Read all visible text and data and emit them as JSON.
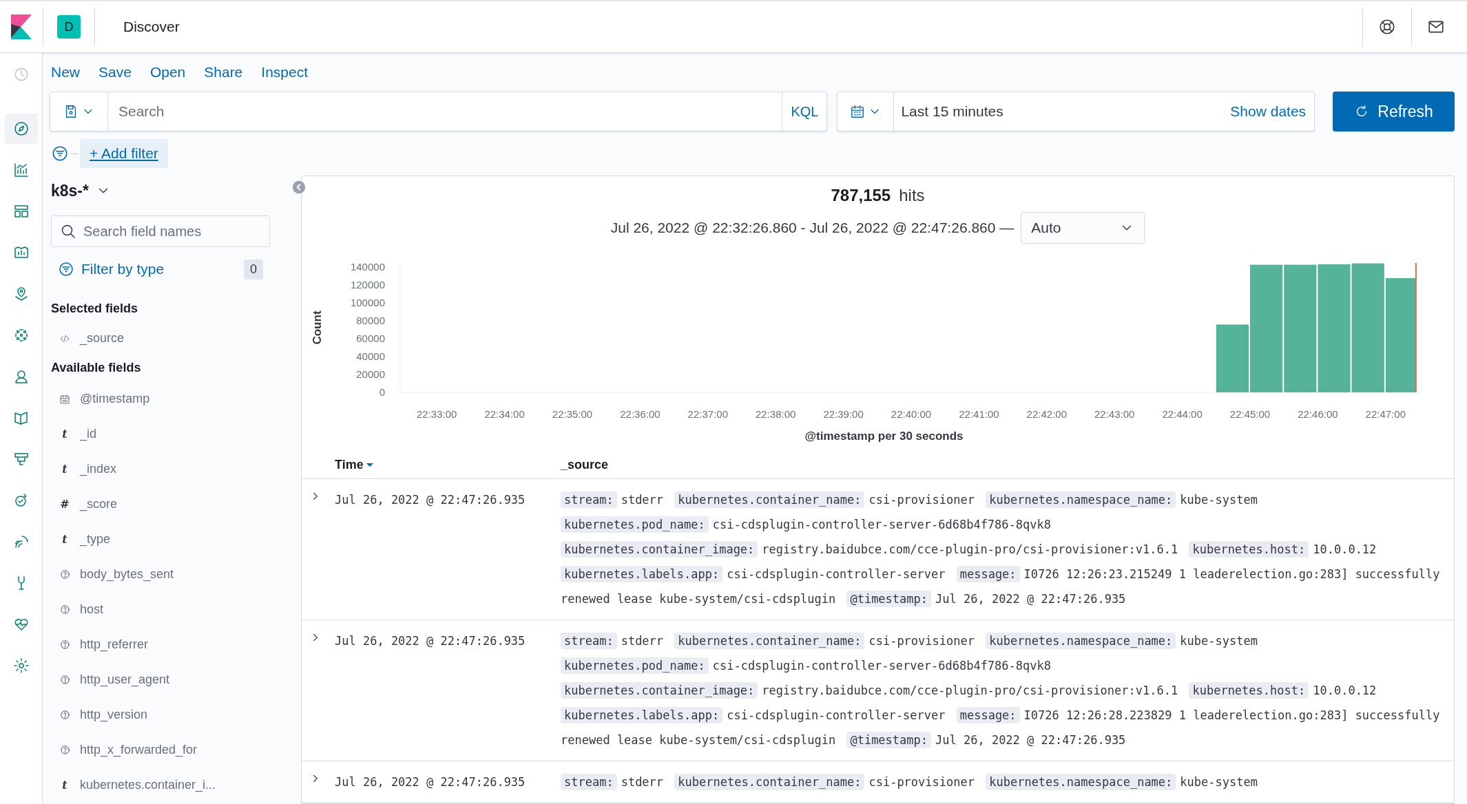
{
  "header": {
    "avatar": "D",
    "title": "Discover"
  },
  "nav": [
    {
      "selected": true
    },
    {
      "selected": false
    },
    {
      "selected": false
    },
    {
      "selected": false
    },
    {
      "selected": false
    },
    {
      "selected": false
    },
    {
      "selected": false
    },
    {
      "selected": false
    },
    {
      "selected": false
    },
    {
      "selected": false
    },
    {
      "selected": false
    },
    {
      "selected": false
    },
    {
      "selected": false
    },
    {
      "selected": false
    }
  ],
  "menu": [
    "New",
    "Save",
    "Open",
    "Share",
    "Inspect"
  ],
  "query": {
    "placeholder": "Search",
    "language": "KQL"
  },
  "time": {
    "range": "Last 15 minutes",
    "show_dates": "Show dates",
    "refresh": "Refresh"
  },
  "filter": {
    "add": "+ Add filter"
  },
  "sidebar": {
    "index_pattern": "k8s-*",
    "search_placeholder": "Search field names",
    "filter_by_type": "Filter by type",
    "filter_count": "0",
    "selected_heading": "Selected fields",
    "selected_fields": [
      {
        "kind": "source",
        "name": "_source"
      }
    ],
    "available_heading": "Available fields",
    "available_fields": [
      {
        "kind": "date",
        "name": "@timestamp"
      },
      {
        "kind": "glyph",
        "glyph": "t",
        "name": "_id"
      },
      {
        "kind": "glyph",
        "glyph": "t",
        "name": "_index"
      },
      {
        "kind": "glyph",
        "glyph": "#",
        "name": "_score"
      },
      {
        "kind": "glyph",
        "glyph": "t",
        "name": "_type"
      },
      {
        "kind": "unknown",
        "name": "body_bytes_sent"
      },
      {
        "kind": "unknown",
        "name": "host"
      },
      {
        "kind": "unknown",
        "name": "http_referrer"
      },
      {
        "kind": "unknown",
        "name": "http_user_agent"
      },
      {
        "kind": "unknown",
        "name": "http_version"
      },
      {
        "kind": "unknown",
        "name": "http_x_forwarded_for"
      },
      {
        "kind": "glyph",
        "glyph": "t",
        "name": "kubernetes.container_i..."
      }
    ]
  },
  "hits": {
    "count": "787,155",
    "label": "hits",
    "range": "Jul 26, 2022 @ 22:32:26.860 - Jul 26, 2022 @ 22:47:26.860 —",
    "interval": "Auto"
  },
  "chart_data": {
    "type": "bar",
    "xlabel": "@timestamp per 30 seconds",
    "ylabel": "Count",
    "categories": [
      null,
      "22:33:00",
      null,
      "22:34:00",
      null,
      "22:35:00",
      null,
      "22:36:00",
      null,
      "22:37:00",
      null,
      "22:38:00",
      null,
      "22:39:00",
      null,
      "22:40:00",
      null,
      "22:41:00",
      null,
      "22:42:00",
      null,
      "22:43:00",
      null,
      "22:44:00",
      null,
      "22:45:00",
      null,
      "22:46:00",
      null,
      "22:47:00"
    ],
    "series": [
      {
        "color": "#54b399",
        "values": [
          0,
          0,
          0,
          0,
          0,
          0,
          0,
          0,
          0,
          0,
          0,
          0,
          0,
          0,
          0,
          0,
          0,
          0,
          0,
          0,
          0,
          0,
          0,
          0,
          76000,
          143000,
          143000,
          143500,
          144500,
          128000
        ]
      }
    ],
    "ylim": [
      0,
      145000
    ],
    "yticks": [
      0,
      20000,
      40000,
      60000,
      80000,
      100000,
      120000,
      140000
    ]
  },
  "table": {
    "columns": [
      "Time",
      "_source"
    ],
    "rows": [
      {
        "time": "Jul 26, 2022 @ 22:47:26.935",
        "fields": [
          {
            "key": "stream:",
            "value": "stderr"
          },
          {
            "key": "kubernetes.container_name:",
            "value": "csi-provisioner"
          },
          {
            "key": "kubernetes.namespace_name:",
            "value": "kube-system"
          },
          {
            "key": "kubernetes.pod_name:",
            "value": "csi-cdsplugin-controller-server-6d68b4f786-8qvk8"
          },
          {
            "key": "kubernetes.container_image:",
            "value": "registry.baidubce.com/cce-plugin-pro/csi-provisioner:v1.6.1"
          },
          {
            "key": "kubernetes.host:",
            "value": "10.0.0.12"
          },
          {
            "key": "kubernetes.labels.app:",
            "value": "csi-cdsplugin-controller-server"
          },
          {
            "key": "message:",
            "value": "I0726 12:26:23.215249 1 leaderelection.go:283] successfully renewed lease kube-system/csi-cdsplugin"
          },
          {
            "key": "@timestamp:",
            "value": "Jul 26, 2022 @ 22:47:26.935"
          }
        ]
      },
      {
        "time": "Jul 26, 2022 @ 22:47:26.935",
        "fields": [
          {
            "key": "stream:",
            "value": "stderr"
          },
          {
            "key": "kubernetes.container_name:",
            "value": "csi-provisioner"
          },
          {
            "key": "kubernetes.namespace_name:",
            "value": "kube-system"
          },
          {
            "key": "kubernetes.pod_name:",
            "value": "csi-cdsplugin-controller-server-6d68b4f786-8qvk8"
          },
          {
            "key": "kubernetes.container_image:",
            "value": "registry.baidubce.com/cce-plugin-pro/csi-provisioner:v1.6.1"
          },
          {
            "key": "kubernetes.host:",
            "value": "10.0.0.12"
          },
          {
            "key": "kubernetes.labels.app:",
            "value": "csi-cdsplugin-controller-server"
          },
          {
            "key": "message:",
            "value": "I0726 12:26:28.223829 1 leaderelection.go:283] successfully renewed lease kube-system/csi-cdsplugin"
          },
          {
            "key": "@timestamp:",
            "value": "Jul 26, 2022 @ 22:47:26.935"
          }
        ]
      },
      {
        "time": "Jul 26, 2022 @ 22:47:26.935",
        "fields": [
          {
            "key": "stream:",
            "value": "stderr"
          },
          {
            "key": "kubernetes.container_name:",
            "value": "csi-provisioner"
          },
          {
            "key": "kubernetes.namespace_name:",
            "value": "kube-system"
          }
        ]
      }
    ]
  }
}
